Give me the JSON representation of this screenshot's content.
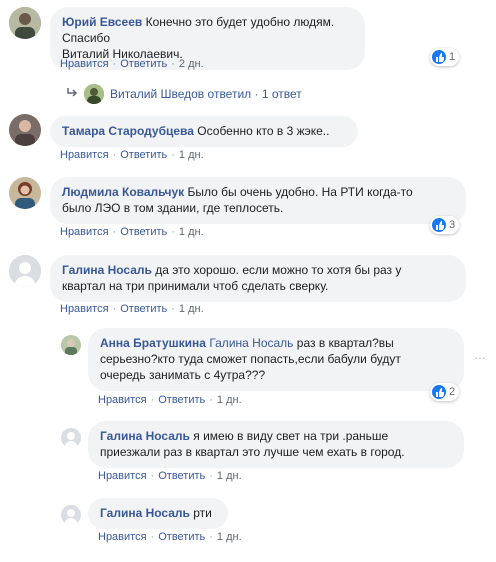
{
  "actions": {
    "like": "Нравится",
    "reply": "Ответить"
  },
  "comments": [
    {
      "author": "Юрий Евсеев",
      "text_line1": "Конечно это будет удобно людям. Спасибо",
      "text_line2": "Виталий Николаевич.",
      "time": "2 дн.",
      "reactions": "1",
      "reply_summary": {
        "name": "Виталий Шведов",
        "verb": "ответил",
        "count": "1 ответ"
      }
    },
    {
      "author": "Тамара Стародубцева",
      "text_line1": "Особенно кто в 3 жэке..",
      "time": "1 дн."
    },
    {
      "author": "Людмила Ковальчук",
      "text_line1": "Было бы очень удобно. На РТИ когда-то",
      "text_line2": "было ЛЭО в том здании, где теплосеть.",
      "time": "1 дн.",
      "reactions": "3"
    },
    {
      "author": "Галина Носаль",
      "text_line1": "да это хорошо. если можно то хотя бы раз у",
      "text_line2": "квартал на три принимали чтоб сделать сверку.",
      "time": "1 дн."
    }
  ],
  "replies": [
    {
      "author": "Анна Братушкина",
      "mention": "Галина Носаль",
      "text_line1": "раз в квартал?вы",
      "text_line2": "серьезно?кто туда сможет попасть,если бабули будут",
      "text_line3": "очередь занимать с 4утра???",
      "time": "1 дн.",
      "reactions": "2"
    },
    {
      "author": "Галина Носаль",
      "text_line1": "я имею в виду свет на три .раньше",
      "text_line2": "приезжали раз в квартал это лучше чем ехать в город.",
      "time": "1 дн."
    },
    {
      "author": "Галина Носаль",
      "text_line1": "рти",
      "time": "1 дн."
    }
  ],
  "colors": {
    "link": "#385898",
    "bubble": "#f2f3f5",
    "like": "#1877f2"
  }
}
